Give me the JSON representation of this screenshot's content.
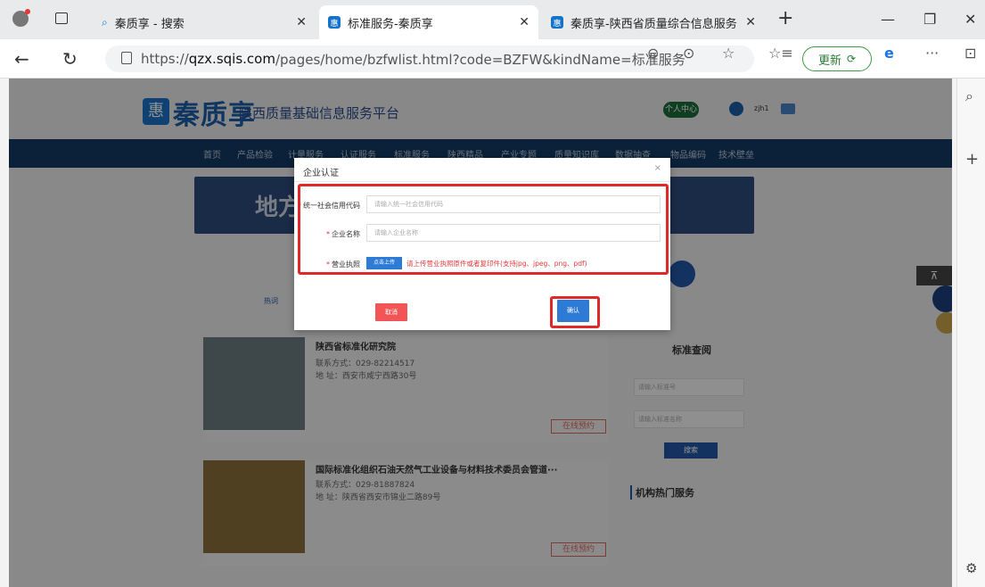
{
  "browser": {
    "tabs": [
      {
        "label": "秦质享 - 搜索",
        "active": false
      },
      {
        "label": "标准服务-秦质享",
        "active": true
      },
      {
        "label": "秦质享-陕西省质量综合信息服务",
        "active": false
      }
    ],
    "url_prefix": "https://",
    "url_domain": "qzx.sqis.com",
    "url_rest": "/pages/home/bzfwlist.html?code=BZFW&kindName=标准服务",
    "update_label": "更新"
  },
  "site": {
    "logo_text": "秦质享",
    "logo_sub": "陕西质量基础信息服务平台",
    "user_center": "个人中心",
    "username": "zjh1",
    "nav": [
      "首页",
      "产品检验",
      "计量服务",
      "认证服务",
      "标准服务",
      "陕西精品",
      "产业专题",
      "质量知识库",
      "数据抽查",
      "物品编码",
      "技术壁垒"
    ],
    "banner_text": "地方标",
    "hot_label": "热词"
  },
  "cards": [
    {
      "title": "陕西省标准化研究院",
      "contact": "联系方式：029-82214517",
      "address": "地 址：西安市咸宁西路30号",
      "action": "在线预约"
    },
    {
      "title": "国际标准化组织石油天然气工业设备与材料技术委员会管道···",
      "contact": "联系方式：029-81887824",
      "address": "地 址：陕西省西安市锦业二路89号",
      "action": "在线预约"
    }
  ],
  "side_panel": {
    "title": "标准查阅",
    "input1_placeholder": "请输入标准号",
    "input2_placeholder": "请输入标准名称",
    "search_label": "搜索",
    "hot_services": "机构热门服务"
  },
  "modal": {
    "title": "企业认证",
    "close": "×",
    "fields": [
      {
        "label": "统一社会信用代码",
        "placeholder": "请输入统一社会信用代码"
      },
      {
        "label": "企业名称",
        "placeholder": "请输入企业名称"
      }
    ],
    "license_label": "营业执照",
    "upload_label": "点击上传",
    "upload_hint": "请上传营业执照原件或者复印件(支持jpg、jpeg、png、pdf)",
    "cancel_label": "取消",
    "confirm_label": "确认"
  },
  "colors": {
    "highlight": "#e0282b",
    "primary": "#2e7bd6",
    "cancel": "#f25555"
  }
}
